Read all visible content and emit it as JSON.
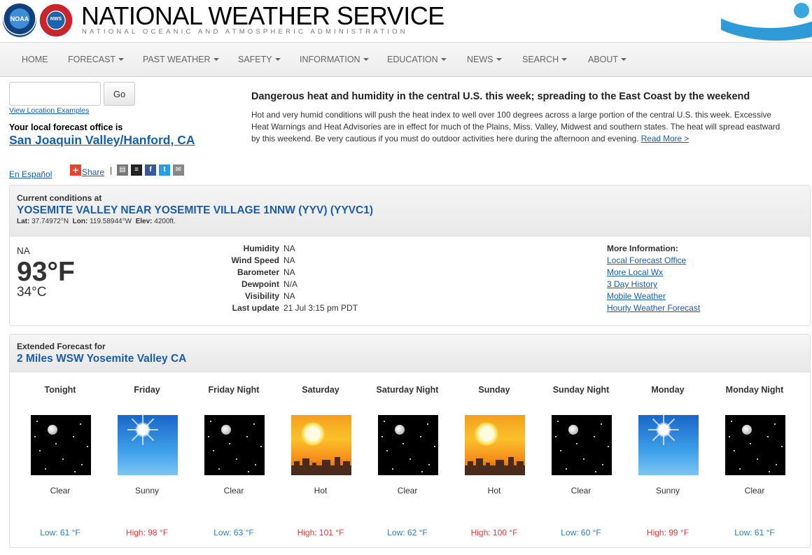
{
  "header": {
    "noaa_logo": "NOAA",
    "nws_logo": "NWS",
    "title": "NATIONAL WEATHER SERVICE",
    "subtitle": "NATIONAL OCEANIC AND ATMOSPHERIC ADMINISTRATION"
  },
  "nav": {
    "items": [
      {
        "label": "HOME",
        "dropdown": false
      },
      {
        "label": "FORECAST",
        "dropdown": true
      },
      {
        "label": "PAST WEATHER",
        "dropdown": true
      },
      {
        "label": "SAFETY",
        "dropdown": true
      },
      {
        "label": "INFORMATION",
        "dropdown": true
      },
      {
        "label": "EDUCATION",
        "dropdown": true
      },
      {
        "label": "NEWS",
        "dropdown": true
      },
      {
        "label": "SEARCH",
        "dropdown": true
      },
      {
        "label": "ABOUT",
        "dropdown": true
      }
    ]
  },
  "search": {
    "value": "",
    "placeholder": "",
    "go_label": "Go",
    "examples_link": "View Location Examples",
    "office_label": "Your local forecast office is",
    "office_link": "San Joaquin Valley/Hanford, CA"
  },
  "headline": {
    "title": "Dangerous heat and humidity in the central U.S. this week; spreading to the East Coast by the weekend",
    "body": "Hot and very humid conditions will push the heat index to well over 100 degrees across a large portion of the central U.S. this week. Excessive Heat Warnings and Heat Advisories are in effect for much of the Plains, Miss. Valley, Midwest and southern states. The heat will spread eastward by this weekend. Be very cautious if you must do outdoor activities here during the afternoon and evening.",
    "read_more": "Read More >"
  },
  "share": {
    "espanol": "En Español",
    "share_label": "Share",
    "separator": "|",
    "icons": [
      "print-icon",
      "buffer-icon",
      "facebook-icon",
      "twitter-icon",
      "email-icon"
    ]
  },
  "current": {
    "heading": "Current conditions at",
    "station": "YOSEMITE VALLEY NEAR YOSEMITE VILLAGE 1NNW (YYV) (YYVC1)",
    "lat_label": "Lat:",
    "lat": "37.74972°N",
    "lon_label": "Lon:",
    "lon": "119.58944°W",
    "elev_label": "Elev:",
    "elev": "4200ft.",
    "condition": "NA",
    "temp_f": "93°F",
    "temp_c": "34°C",
    "details": [
      {
        "label": "Humidity",
        "value": "NA"
      },
      {
        "label": "Wind Speed",
        "value": "NA"
      },
      {
        "label": "Barometer",
        "value": "NA"
      },
      {
        "label": "Dewpoint",
        "value": "N/A"
      },
      {
        "label": "Visibility",
        "value": "NA"
      },
      {
        "label": "Last update",
        "value": "21 Jul 3:15 pm PDT"
      }
    ],
    "more_info_label": "More Information:",
    "more_info_links": [
      "Local Forecast Office",
      "More Local Wx",
      "3 Day History",
      "Mobile Weather",
      "Hourly Weather Forecast"
    ]
  },
  "extended": {
    "heading": "Extended Forecast for",
    "location": "2 Miles WSW Yosemite Valley CA",
    "periods": [
      {
        "name": "Tonight",
        "icon": "night-clear",
        "short": "Clear",
        "temp": "Low: 61 °F",
        "kind": "low"
      },
      {
        "name": "Friday",
        "icon": "sunny",
        "short": "Sunny",
        "temp": "High: 98 °F",
        "kind": "high"
      },
      {
        "name": "Friday Night",
        "icon": "night-clear",
        "short": "Clear",
        "temp": "Low: 63 °F",
        "kind": "low"
      },
      {
        "name": "Saturday",
        "icon": "hot",
        "short": "Hot",
        "temp": "High: 101 °F",
        "kind": "high"
      },
      {
        "name": "Saturday Night",
        "icon": "night-clear",
        "short": "Clear",
        "temp": "Low: 62 °F",
        "kind": "low"
      },
      {
        "name": "Sunday",
        "icon": "hot",
        "short": "Hot",
        "temp": "High: 100 °F",
        "kind": "high"
      },
      {
        "name": "Sunday Night",
        "icon": "night-clear",
        "short": "Clear",
        "temp": "Low: 60 °F",
        "kind": "low"
      },
      {
        "name": "Monday",
        "icon": "sunny",
        "short": "Sunny",
        "temp": "High: 99 °F",
        "kind": "high"
      },
      {
        "name": "Monday Night",
        "icon": "night-clear",
        "short": "Clear",
        "temp": "Low: 61 °F",
        "kind": "low"
      }
    ]
  },
  "colors": {
    "link": "#1b5ea6",
    "low_temp": "#2a7fc1",
    "high_temp": "#d9413a",
    "share_plus": "#e8432e"
  }
}
